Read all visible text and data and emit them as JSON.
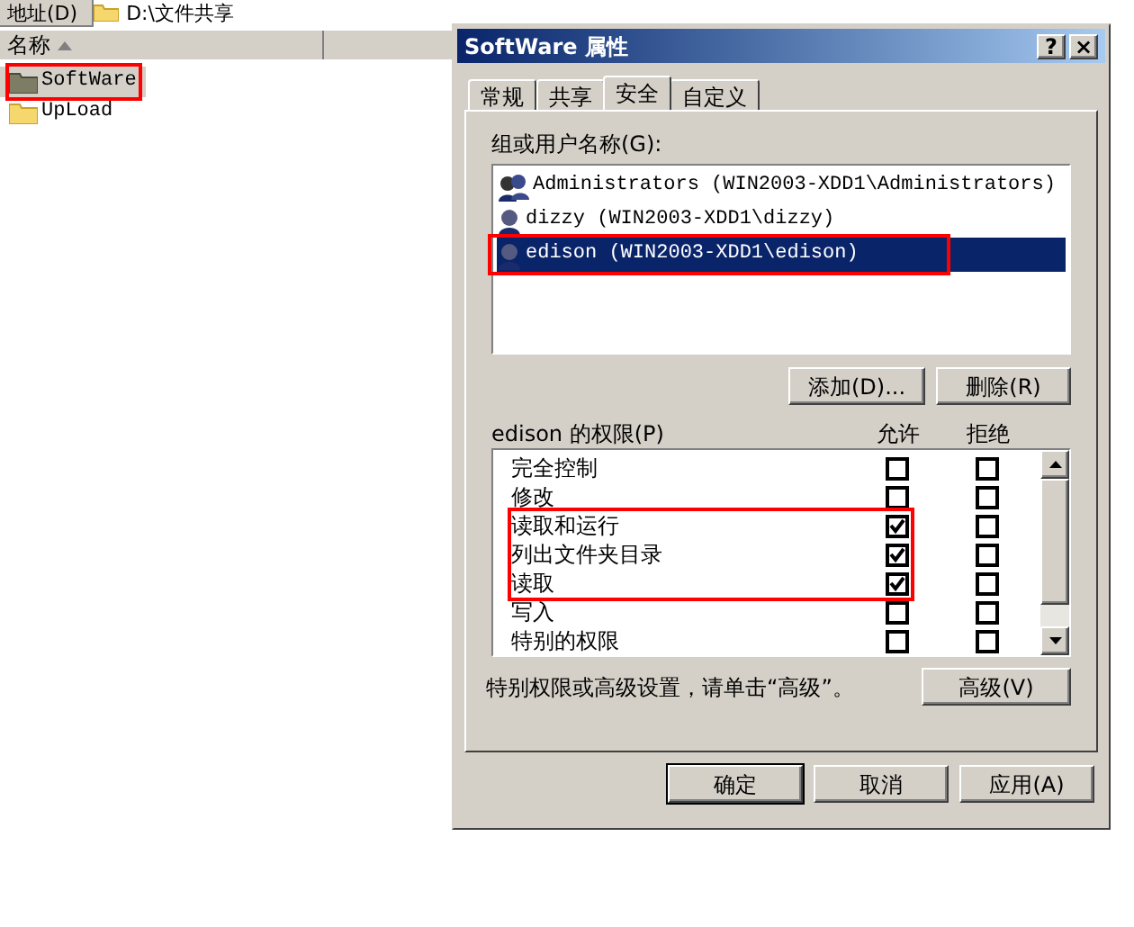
{
  "explorer": {
    "address_label": "地址(D)",
    "address": "D:\\文件共享",
    "columns": [
      "名称"
    ],
    "items": [
      {
        "name": "SoftWare",
        "selected": true,
        "highlighted": true
      },
      {
        "name": "UpLoad",
        "selected": false,
        "highlighted": false
      }
    ]
  },
  "dialog": {
    "title": "SoftWare 属性",
    "help": "?",
    "close": "×",
    "tabs": [
      {
        "label": "常规",
        "selected": false
      },
      {
        "label": "共享",
        "selected": false
      },
      {
        "label": "安全",
        "selected": true
      },
      {
        "label": "自定义",
        "selected": false
      }
    ],
    "users_label": "组或用户名称(G):",
    "users": [
      {
        "name": "Administrators (WIN2003-XDD1\\Administrators)",
        "kind": "group",
        "selected": false,
        "highlighted": false
      },
      {
        "name": "dizzy (WIN2003-XDD1\\dizzy)",
        "kind": "user",
        "selected": false,
        "highlighted": false
      },
      {
        "name": "edison (WIN2003-XDD1\\edison)",
        "kind": "user",
        "selected": true,
        "highlighted": true
      }
    ],
    "add_button": "添加(D)...",
    "remove_button": "删除(R)",
    "permissions_label": "edison 的权限(P)",
    "allow_header": "允许",
    "deny_header": "拒绝",
    "permissions": [
      {
        "name": "完全控制",
        "allow": false,
        "deny": false,
        "highlighted": false
      },
      {
        "name": "修改",
        "allow": false,
        "deny": false,
        "highlighted": false
      },
      {
        "name": "读取和运行",
        "allow": true,
        "deny": false,
        "highlighted": true
      },
      {
        "name": "列出文件夹目录",
        "allow": true,
        "deny": false,
        "highlighted": true
      },
      {
        "name": "读取",
        "allow": true,
        "deny": false,
        "highlighted": true
      },
      {
        "name": "写入",
        "allow": false,
        "deny": false,
        "highlighted": false
      },
      {
        "name": "特别的权限",
        "allow": false,
        "deny": false,
        "highlighted": false
      }
    ],
    "advanced_hint": "特别权限或高级设置，请单击“高级”。",
    "advanced_button": "高级(V)",
    "buttons": [
      {
        "label": "确定",
        "kind": "default"
      },
      {
        "label": "取消",
        "kind": "normal"
      },
      {
        "label": "应用(A)",
        "kind": "normal"
      }
    ]
  }
}
